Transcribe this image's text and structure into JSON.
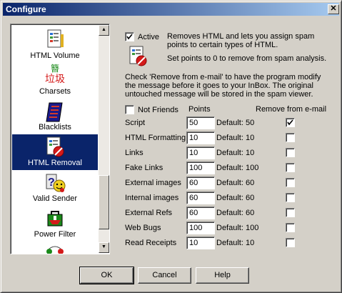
{
  "window": {
    "title": "Configure",
    "close_glyph": "✕"
  },
  "sidebar": {
    "items": [
      {
        "label": "HTML Volume",
        "icon": "html-volume-icon"
      },
      {
        "label": "Charsets",
        "icon": "charsets-icon",
        "glyphs_top": "簪",
        "glyphs_main": "垃圾"
      },
      {
        "label": "Blacklists",
        "icon": "blacklist-book-icon"
      },
      {
        "label": "HTML Removal",
        "icon": "html-removal-icon",
        "selected": true
      },
      {
        "label": "Valid Sender",
        "icon": "valid-sender-icon"
      },
      {
        "label": "Power Filter",
        "icon": "power-filter-icon"
      }
    ]
  },
  "active": {
    "label": "Active",
    "checked": true,
    "description": "Removes HTML and lets you assign spam points to certain types of HTML.",
    "hint": "Set points to 0 to remove from spam analysis."
  },
  "instructions": "Check 'Remove from e-mail' to have the program modify the message before it goes to your InBox.  The original untouched message will be stored in the spam viewer.",
  "not_friends": {
    "label": "Not Friends",
    "checked": false
  },
  "headers": {
    "points": "Points",
    "remove": "Remove from e-mail"
  },
  "rows": [
    {
      "label": "Script",
      "points": "50",
      "default": "Default: 50",
      "remove": true
    },
    {
      "label": "HTML Formatting",
      "points": "10",
      "default": "Default: 10",
      "remove": false
    },
    {
      "label": "Links",
      "points": "10",
      "default": "Default: 10",
      "remove": false
    },
    {
      "label": "Fake Links",
      "points": "100",
      "default": "Default: 100",
      "remove": false
    },
    {
      "label": "External images",
      "points": "60",
      "default": "Default: 60",
      "remove": false
    },
    {
      "label": "Internal images",
      "points": "60",
      "default": "Default: 60",
      "remove": false
    },
    {
      "label": "External Refs",
      "points": "60",
      "default": "Default: 60",
      "remove": false
    },
    {
      "label": "Web Bugs",
      "points": "100",
      "default": "Default: 100",
      "remove": false
    },
    {
      "label": "Read Receipts",
      "points": "10",
      "default": "Default: 10",
      "remove": false
    }
  ],
  "buttons": {
    "ok": "OK",
    "cancel": "Cancel",
    "help": "Help"
  }
}
